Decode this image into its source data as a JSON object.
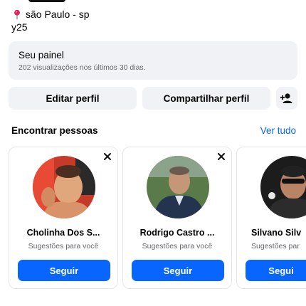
{
  "profile": {
    "location": "são Paulo - sp",
    "bio": "y25"
  },
  "panel": {
    "title": "Seu painel",
    "subtitle": "202 visualizações nos últimos 30 dias."
  },
  "actions": {
    "edit_label": "Editar perfil",
    "share_label": "Compartilhar perfil",
    "add_icon": "add-person-icon"
  },
  "people": {
    "title": "Encontrar pessoas",
    "see_all": "Ver tudo",
    "cards": [
      {
        "name": "Cholinha Dos S...",
        "subtitle": "Sugestões para você",
        "follow": "Seguir"
      },
      {
        "name": "Rodrigo Castro ...",
        "subtitle": "Sugestões para você",
        "follow": "Seguir"
      },
      {
        "name": "Silvano Silv",
        "subtitle": "Sugestões par",
        "follow": "Segui"
      }
    ]
  },
  "colors": {
    "accent": "#0866ff",
    "panel_bg": "#f0f2f5",
    "muted_text": "#65676b"
  }
}
